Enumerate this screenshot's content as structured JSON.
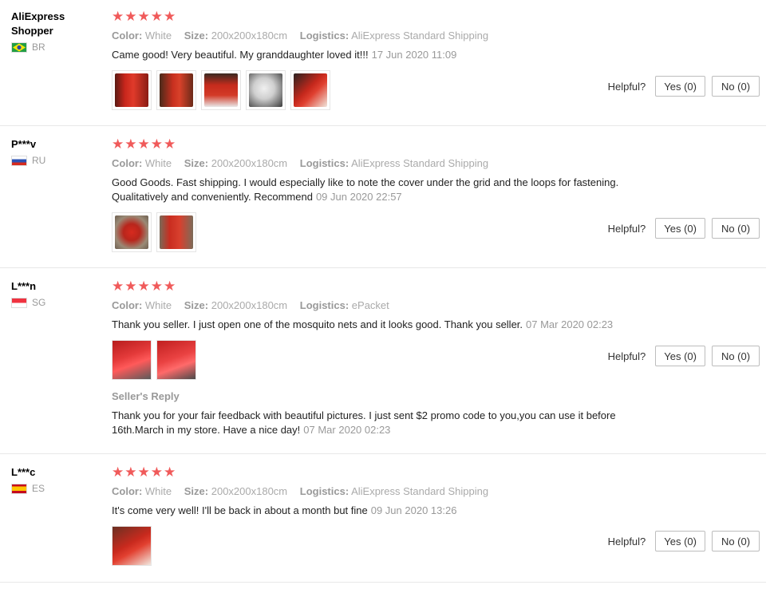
{
  "labels": {
    "color": "Color:",
    "size": "Size:",
    "logistics": "Logistics:",
    "helpful": "Helpful?",
    "seller_reply": "Seller's Reply"
  },
  "reviews": [
    {
      "user": "AliExpress Shopper",
      "country": "BR",
      "stars": 5,
      "color": "White",
      "size": "200x200x180cm",
      "logistics": "AliExpress Standard Shipping",
      "text": "Came good! Very beautiful. My granddaughter loved it!!!",
      "date": "17 Jun 2020 11:09",
      "photos": 5,
      "yes": "Yes (0)",
      "no": "No (0)"
    },
    {
      "user": "P***v",
      "country": "RU",
      "stars": 5,
      "color": "White",
      "size": "200x200x180cm",
      "logistics": "AliExpress Standard Shipping",
      "text": "Good Goods. Fast shipping. I would especially like to note the cover under the grid and the loops for fastening. Qualitatively and conveniently. Recommend",
      "date": "09 Jun 2020 22:57",
      "photos": 2,
      "yes": "Yes (0)",
      "no": "No (0)"
    },
    {
      "user": "L***n",
      "country": "SG",
      "stars": 5,
      "color": "White",
      "size": "200x200x180cm",
      "logistics": "ePacket",
      "text": "Thank you seller. I just open one of the mosquito nets and it looks good. Thank you seller.",
      "date": "07 Mar 2020 02:23",
      "photos": 2,
      "yes": "Yes (0)",
      "no": "No (0)",
      "seller_reply": {
        "text": "Thank you for your fair feedback with beautiful pictures. I just sent $2 promo code to you,you can use it before 16th.March in my store. Have a nice day!",
        "date": "07 Mar 2020 02:23"
      }
    },
    {
      "user": "L***c",
      "country": "ES",
      "stars": 5,
      "color": "White",
      "size": "200x200x180cm",
      "logistics": "AliExpress Standard Shipping",
      "text": "It's come very well! I'll be back in about a month but fine",
      "date": "09 Jun 2020 13:26",
      "photos": 1,
      "yes": "Yes (0)",
      "no": "No (0)"
    }
  ],
  "colors": {
    "star": "#f05a5a",
    "muted": "#999999",
    "separator": "#e8e8e8"
  }
}
